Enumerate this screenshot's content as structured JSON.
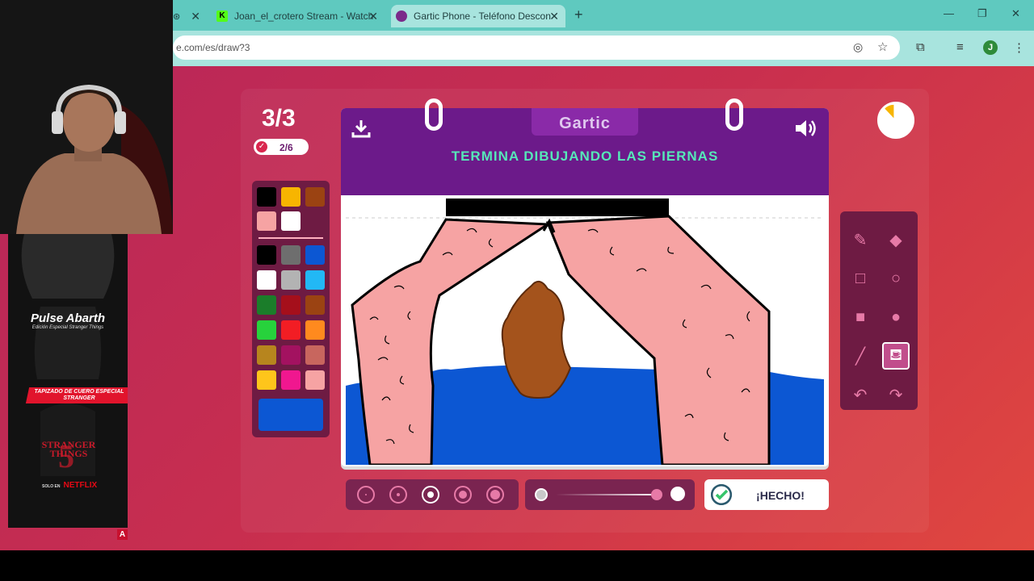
{
  "browser": {
    "tabs": [
      {
        "title": "Joan_el_crotero Stream - Watch",
        "active": false
      },
      {
        "title": "Gartic Phone - Teléfono Descon",
        "active": true
      }
    ],
    "url": "e.com/es/draw?3",
    "profile_initial": "J"
  },
  "game": {
    "round": "3/3",
    "players": "2/6",
    "logo": "Gartic",
    "prompt": "TERMINA DIBUJANDO LAS PIERNAS",
    "done_label": "¡HECHO!",
    "selected_tool": "bucket",
    "selected_brush_size_index": 2,
    "current_color": "#0c57d3",
    "timer_remaining_fraction": 0.12
  },
  "palette": {
    "top_row": [
      "#000000",
      "#f7b500",
      "#9b4312",
      "#f6a3a3",
      "#ffffff"
    ],
    "grid": [
      "#000000",
      "#6e6e6e",
      "#0c57d3",
      "#ffffff",
      "#b3b3b3",
      "#22b8f5",
      "#1b7d2a",
      "#a50f1b",
      "#9b4312",
      "#27d23c",
      "#f21d24",
      "#ff8a1e",
      "#b7851e",
      "#a31260",
      "#c8665e",
      "#fec51b",
      "#f0178f",
      "#f6a3a3"
    ]
  },
  "tools": [
    "pencil-icon",
    "eraser-icon",
    "rect-outline-icon",
    "ellipse-outline-icon",
    "rect-fill-icon",
    "ellipse-fill-icon",
    "line-icon",
    "bucket-icon",
    "undo-icon",
    "redo-icon"
  ],
  "promo": {
    "title": "Pulse Abarth",
    "subtitle": "Edición Especial Stranger Things",
    "band": "TAPIZADO DE CUERO ESPECIAL STRANGER",
    "show": "STRANGER THINGS",
    "season": "5",
    "only_on": "SOLO EN",
    "network": "NETFLIX",
    "corner": "A"
  }
}
